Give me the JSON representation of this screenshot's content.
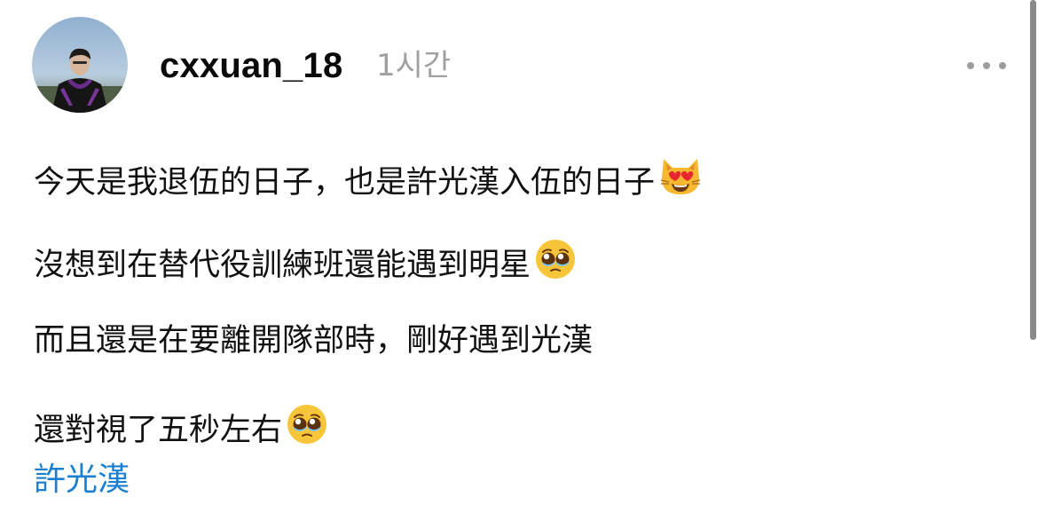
{
  "post": {
    "username": "cxxuan_18",
    "timestamp": "1시간",
    "lines": [
      {
        "text": "今天是我退伍的日子，也是許光漢入伍的日子",
        "emoji": "heart-eyes-cat-emoji"
      },
      {
        "text": "沒想到在替代役訓練班還能遇到明星",
        "emoji": "pleading-face-emoji"
      },
      {
        "text": "而且還是在要離開隊部時，剛好遇到光漢",
        "emoji": ""
      },
      {
        "text": "還對視了五秒左右",
        "emoji": "pleading-face-emoji"
      }
    ],
    "tag": "許光漢"
  },
  "colors": {
    "username": "#0a0a0a",
    "timestamp": "#a0a0a0",
    "link": "#1b7fd1",
    "text": "#111111"
  },
  "icons": {
    "more": "more-horizontal-icon"
  }
}
